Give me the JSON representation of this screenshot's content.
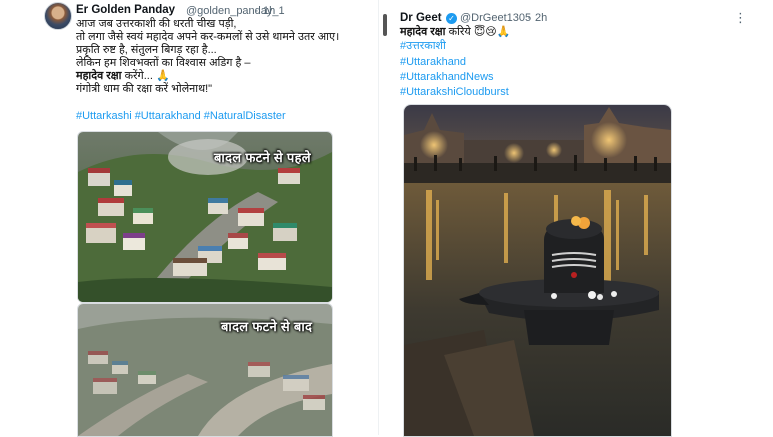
{
  "left_tweet": {
    "name": "Er Golden Panday",
    "handle": "@golden_panday_1",
    "separator": "·",
    "time": "1h",
    "lines": [
      "आज जब उत्तरकाशी की धरती चीख पड़ी,",
      "तो लगा जैसे स्वयं महादेव अपने कर-कमलों से उसे थामने उतर आए।",
      "प्रकृति रुष्ट है, संतुलन बिगड़ रहा है...",
      "लेकिन हम शिवभक्तों का विश्वास अडिग है –"
    ],
    "bold_line": "महादेव रक्षा",
    "bold_line_rest": " करेंगे... 🙏",
    "last_line": "गंगोत्री धाम की रक्षा करें भोलेनाथ!\"",
    "hashtags": "#Uttarkashi #Uttarakhand #NaturalDisaster",
    "caption_before": "बादल फटने से पहले",
    "caption_after": "बादल फटने से बाद"
  },
  "right_tweet": {
    "name": "Dr Geet",
    "handle": "@DrGeet1305",
    "separator": "·",
    "time": "2h",
    "more": "⋮",
    "text_bold": "महादेव रक्षा",
    "text_rest": " करिये 😇😢🙏",
    "hashtags": [
      "#उत्तरकाशी",
      "#Uttarakhand",
      "#UttarakhandNews",
      "#UttarakshiCloudburst"
    ]
  }
}
